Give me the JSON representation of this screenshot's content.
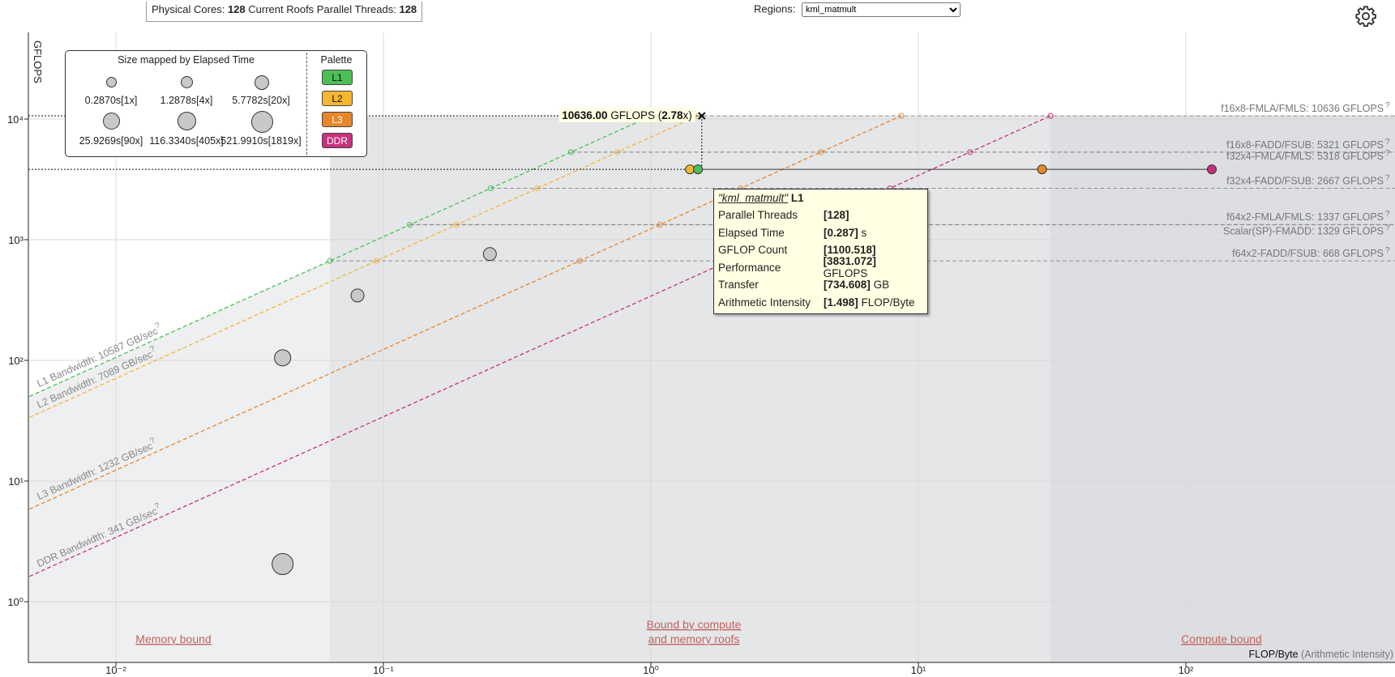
{
  "header": {
    "cores_label": "Physical Cores:",
    "cores_value": "128",
    "roofs_label": "Current Roofs Parallel Threads:",
    "roofs_value": "128",
    "regions_label": "Regions:",
    "regions_selected": "kml_matmult"
  },
  "colors": {
    "L1": "#4dbf57",
    "L2": "#f5b731",
    "L3": "#e8862a",
    "DDR": "#c7317d",
    "region_text": "#c0645f",
    "shade": "#e5e6e8"
  },
  "legend": {
    "title": "Size mapped by Elapsed Time",
    "palette_title": "Palette",
    "sizes": [
      {
        "label": "0.2870s[1x]"
      },
      {
        "label": "1.2878s[4x]"
      },
      {
        "label": "5.7782s[20x]"
      },
      {
        "label": "25.9269s[90x]"
      },
      {
        "label": "116.3340s[405x]"
      },
      {
        "label": "521.9910s[1819x]"
      }
    ],
    "palette": [
      "L1",
      "L2",
      "L3",
      "DDR"
    ]
  },
  "chart_data": {
    "type": "scatter",
    "xscale": "log",
    "yscale": "log",
    "xlim": [
      0.005,
      250
    ],
    "ylim": [
      0.5,
      50000
    ],
    "ylabel": "GFLOPS",
    "xlabel_main": "FLOP/Byte",
    "xlabel_paren": "(Arithmetic Intensity)",
    "x_ticks": [
      {
        "v": 0.01,
        "label": "10⁻²"
      },
      {
        "v": 0.1,
        "label": "10⁻¹"
      },
      {
        "v": 1,
        "label": "10⁰"
      },
      {
        "v": 10,
        "label": "10¹"
      },
      {
        "v": 100,
        "label": "10²"
      }
    ],
    "y_ticks": [
      {
        "v": 1,
        "label": "10⁰"
      },
      {
        "v": 10,
        "label": "10¹"
      },
      {
        "v": 100,
        "label": "10²"
      },
      {
        "v": 1000,
        "label": "10³"
      },
      {
        "v": 10000,
        "label": "10⁴"
      }
    ],
    "compute_roofs": [
      {
        "label": "f16x8-FMLA/FMLS: 10636 GFLOPS",
        "value": 10636
      },
      {
        "label": "f16x8-FADD/FSUB: 5321 GFLOPS",
        "value": 5321
      },
      {
        "label": "f32x4-FMLA/FMLS: 5318 GFLOPS",
        "value": 5318
      },
      {
        "label": "f32x4-FADD/FSUB: 2667 GFLOPS",
        "value": 2667
      },
      {
        "label": "f64x2-FMLA/FMLS: 1337 GFLOPS",
        "value": 1337
      },
      {
        "label": "Scalar(SP)-FMADD: 1329 GFLOPS",
        "value": 1329
      },
      {
        "label": "f64x2-FADD/FSUB: 668 GFLOPS",
        "value": 668
      }
    ],
    "bandwidth_roofs": [
      {
        "name": "L1",
        "label": "L1 Bandwidth: 10587 GB/sec",
        "value": 10587
      },
      {
        "name": "L2",
        "label": "L2 Bandwidth: 7089 GB/sec",
        "value": 7089
      },
      {
        "name": "L3",
        "label": "L3 Bandwidth: 1232 GB/sec",
        "value": 1232
      },
      {
        "name": "DDR",
        "label": "DDR Bandwidth: 341 GB/sec",
        "value": 341
      }
    ],
    "roof_question_mark": "?",
    "points": [
      {
        "x": 0.042,
        "y": 105,
        "size": 20
      },
      {
        "x": 0.08,
        "y": 345,
        "size": 16
      },
      {
        "x": 0.25,
        "y": 760,
        "size": 16
      },
      {
        "x": 0.042,
        "y": 2.05,
        "size": 26
      }
    ],
    "selected": {
      "performance": 3831.072,
      "levels": [
        {
          "name": "L2",
          "x": 1.4
        },
        {
          "name": "L1",
          "x": 1.5
        },
        {
          "name": "L3",
          "x": 29
        },
        {
          "name": "DDR",
          "x": 125
        }
      ]
    },
    "peak": {
      "value_text": "10636.00",
      "unit_text": "GFLOPS",
      "ratio_text": "2.78",
      "open": "(",
      "close": "x)",
      "x": 1.55,
      "y": 10636
    },
    "regions": {
      "memory": [
        "Memory bound"
      ],
      "both": [
        "Bound by compute",
        "and memory roofs"
      ],
      "compute": [
        "Compute bound"
      ]
    }
  },
  "tooltip": {
    "name": "\"kml_matmult\"",
    "level": "L1",
    "rows": [
      {
        "key": "Parallel Threads",
        "value": "[128]",
        "unit": ""
      },
      {
        "key": "Elapsed Time",
        "value": "[0.287]",
        "unit": "s"
      },
      {
        "key": "GFLOP Count",
        "value": "[1100.518]",
        "unit": ""
      },
      {
        "key": "Performance",
        "value": "[3831.072]",
        "unit": "GFLOPS"
      },
      {
        "key": "Transfer",
        "value": "[734.608]",
        "unit": "GB"
      },
      {
        "key": "Arithmetic Intensity",
        "value": "[1.498]",
        "unit": "FLOP/Byte"
      }
    ]
  }
}
